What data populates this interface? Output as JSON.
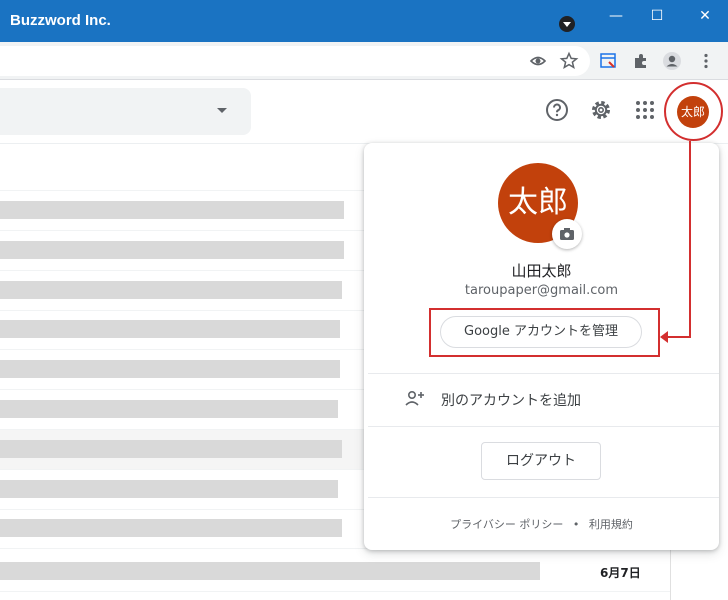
{
  "window": {
    "title": "Buzzword Inc.",
    "minimize_glyph": "—",
    "maximize_glyph": "☐",
    "close_glyph": "✕"
  },
  "header": {
    "avatar_text": "太郎"
  },
  "account_popup": {
    "avatar_text": "太郎",
    "name": "山田太郎",
    "email": "taroupaper@gmail.com",
    "manage_button": "Google アカウントを管理",
    "add_account_label": "別のアカウントを追加",
    "logout_button": "ログアウト",
    "footer_privacy": "プライバシー ポリシー",
    "footer_sep": "•",
    "footer_terms": "利用規約"
  },
  "mail_list": {
    "last_row_date": "6月7日"
  },
  "colors": {
    "title_bar": "#1a73c2",
    "avatar": "#c2410c",
    "callout": "#d32f2f"
  }
}
